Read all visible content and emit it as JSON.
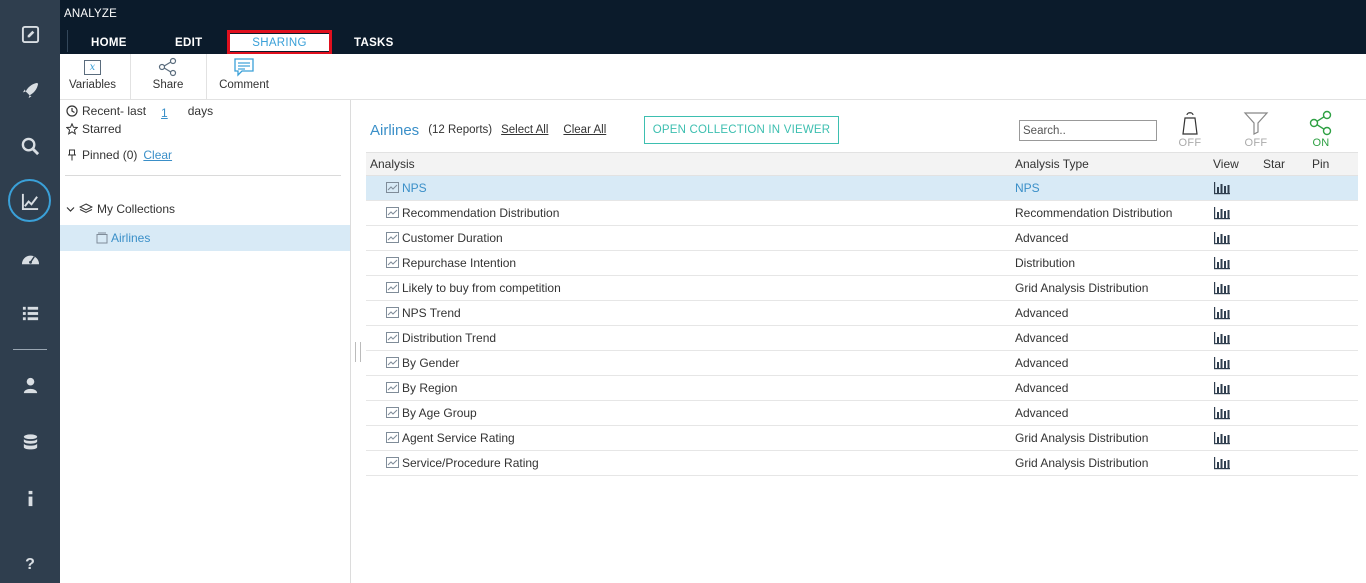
{
  "app": {
    "title": "ANALYZE"
  },
  "tabs": [
    {
      "label": "HOME"
    },
    {
      "label": "EDIT"
    },
    {
      "label": "SHARING",
      "active": true
    },
    {
      "label": "TASKS"
    }
  ],
  "toolbar": {
    "variables": {
      "label": "Variables",
      "icon": "variable-x-icon"
    },
    "share": {
      "label": "Share",
      "icon": "share-icon"
    },
    "comment": {
      "label": "Comment",
      "icon": "comment-icon"
    }
  },
  "rail": {
    "icons": [
      "edit-icon",
      "rocket-icon",
      "search-icon",
      "analyze-chart-icon",
      "dashboard-gauge-icon",
      "list-icon",
      "user-icon",
      "database-icon",
      "info-icon",
      "help-icon"
    ],
    "active": "analyze-chart-icon",
    "active_color": "#3aa0d8"
  },
  "left_panel": {
    "recent": {
      "prefix": "Recent- last",
      "value": "1",
      "suffix": "days"
    },
    "starred": {
      "label": "Starred"
    },
    "pinned": {
      "label": "Pinned (0)",
      "clear": "Clear"
    },
    "my_collections": {
      "label": "My Collections"
    },
    "collections": [
      {
        "label": "Airlines",
        "selected": true
      }
    ]
  },
  "main": {
    "collection_title": "Airlines",
    "report_count": "(12 Reports)",
    "select_all": "Select All",
    "clear_all": "Clear All",
    "open_button": "OPEN COLLECTION IN VIEWER",
    "search_placeholder": "Search..",
    "toggles": [
      {
        "icon": "bell-icon",
        "label": "OFF",
        "color": "#aaaaaa"
      },
      {
        "icon": "filter-icon",
        "label": "OFF",
        "color": "#aaaaaa"
      },
      {
        "icon": "share-network-icon",
        "label": "ON",
        "color": "#2ea043"
      }
    ],
    "columns": [
      "Analysis",
      "Analysis Type",
      "View",
      "Star",
      "Pin"
    ],
    "rows": [
      {
        "name": "NPS",
        "type": "NPS",
        "selected": true
      },
      {
        "name": "Recommendation Distribution",
        "type": "Recommendation Distribution"
      },
      {
        "name": "Customer Duration",
        "type": "Advanced"
      },
      {
        "name": "Repurchase Intention",
        "type": "Distribution"
      },
      {
        "name": "Likely to buy from competition",
        "type": "Grid Analysis Distribution"
      },
      {
        "name": "NPS Trend",
        "type": "Advanced"
      },
      {
        "name": "Distribution Trend",
        "type": "Advanced"
      },
      {
        "name": "By Gender",
        "type": "Advanced"
      },
      {
        "name": "By Region",
        "type": "Advanced"
      },
      {
        "name": "By Age Group",
        "type": "Advanced"
      },
      {
        "name": "Agent Service Rating",
        "type": "Grid Analysis Distribution"
      },
      {
        "name": "Service/Procedure Rating",
        "type": "Grid Analysis Distribution"
      }
    ]
  }
}
